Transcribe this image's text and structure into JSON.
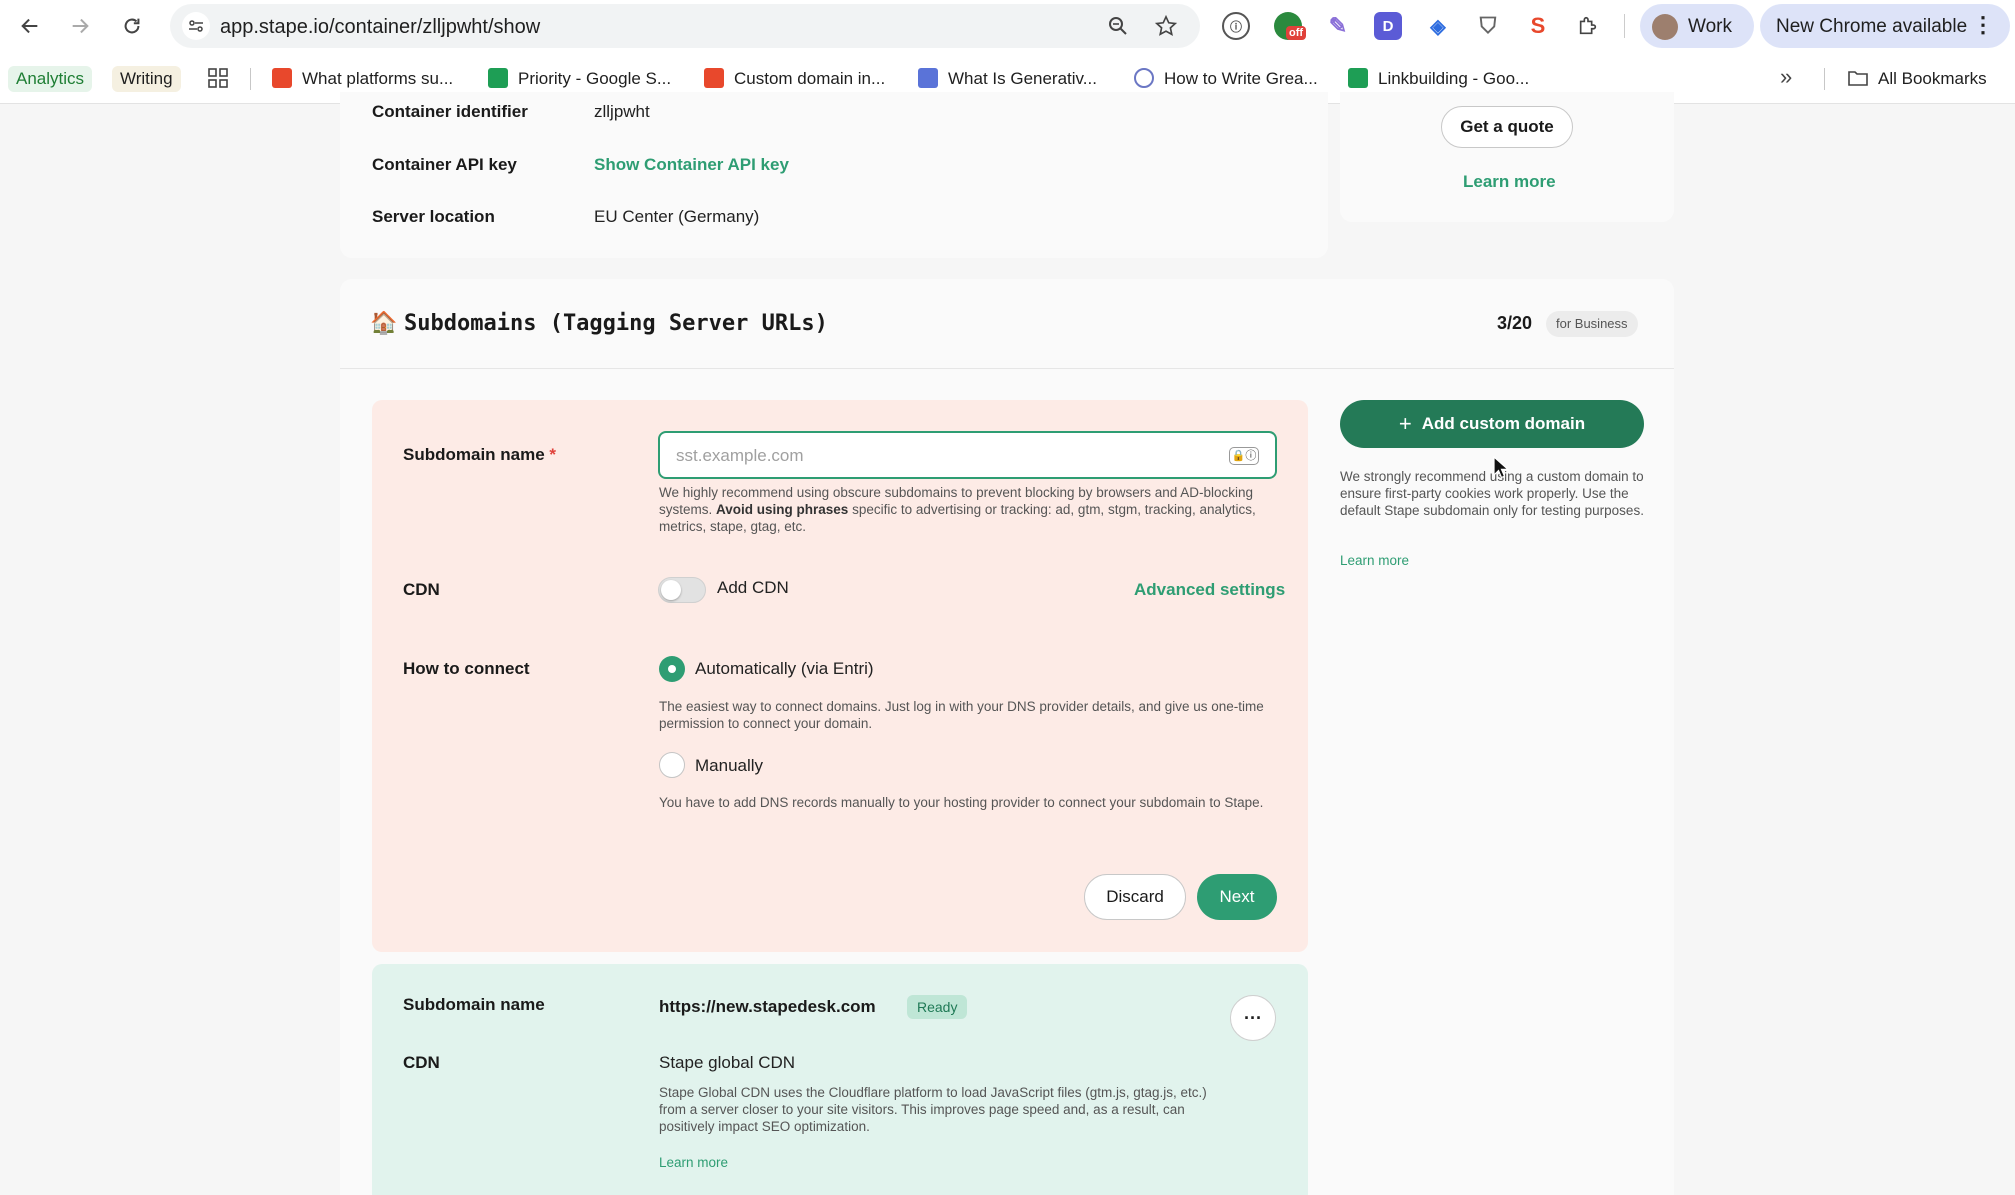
{
  "browser": {
    "url": "app.stape.io/container/zlljpwht/show",
    "profile_label": "Work",
    "update_label": "New Chrome available",
    "ext_off_badge": "off",
    "bookmark_groups": [
      "Analytics",
      "Writing"
    ],
    "bookmarks": [
      {
        "label": "What platforms su...",
        "icon": "stape-icon",
        "color": "#e8482c"
      },
      {
        "label": "Priority - Google S...",
        "icon": "google-sheets-icon",
        "color": "#1e9e55"
      },
      {
        "label": "Custom domain in...",
        "icon": "stape-icon",
        "color": "#e8482c"
      },
      {
        "label": "What Is Generativ...",
        "icon": "mail-icon",
        "color": "#5a73d8"
      },
      {
        "label": "How to Write Grea...",
        "icon": "globe-icon",
        "color": "#6b77c4"
      },
      {
        "label": "Linkbuilding - Goo...",
        "icon": "google-sheets-icon",
        "color": "#1e9e55"
      }
    ],
    "all_bookmarks_label": "All Bookmarks"
  },
  "container_info": {
    "identifier_label": "Container identifier",
    "identifier_value": "zlljpwht",
    "api_key_label": "Container API key",
    "api_key_link": "Show Container API key",
    "location_label": "Server location",
    "location_value": "EU Center (Germany)"
  },
  "quote_card": {
    "button": "Get a quote",
    "learn_more": "Learn more"
  },
  "subdomains": {
    "title": "Subdomains (Tagging Server URLs)",
    "count": "3/20",
    "plan_badge": "for Business",
    "form": {
      "name_label": "Subdomain name",
      "required_mark": "*",
      "placeholder": "sst.example.com",
      "hint_1": "We highly recommend using obscure subdomains to prevent blocking by browsers and AD-blocking systems.",
      "hint_bold": "Avoid using phrases",
      "hint_2": "specific to advertising or tracking: ad, gtm, stgm, tracking, analytics, metrics, stape, gtag, etc.",
      "cdn_label": "CDN",
      "cdn_toggle_label": "Add CDN",
      "advanced_settings": "Advanced settings",
      "connect_label": "How to connect",
      "auto_option": "Automatically (via Entri)",
      "auto_desc": "The easiest way to connect domains. Just log in with your DNS provider details, and give us one-time permission to connect your domain.",
      "manual_option": "Manually",
      "manual_desc": "You have to add DNS records manually to your hosting provider to connect your subdomain to Stape.",
      "discard": "Discard",
      "next": "Next"
    },
    "side": {
      "add_button": "Add custom domain",
      "recommendation": "We strongly recommend using a custom domain to ensure first-party cookies work properly. Use the default Stape subdomain only for testing purposes.",
      "learn_more": "Learn more"
    },
    "existing": {
      "name_label": "Subdomain name",
      "url": "https://new.stapedesk.com",
      "status": "Ready",
      "more": "···",
      "cdn_label": "CDN",
      "cdn_value": "Stape global CDN",
      "cdn_desc": "Stape Global CDN uses the Cloudflare platform to load JavaScript files (gtm.js, gtag.js, etc.) from a server closer to your site visitors. This improves page speed and, as a result, can positively impact SEO optimization.",
      "learn_more": "Learn more"
    }
  },
  "colors": {
    "accent_green": "#2e9d73",
    "dark_green": "#247a57",
    "form_bg": "#fdebe6",
    "info_bg": "#e1f3ed"
  }
}
